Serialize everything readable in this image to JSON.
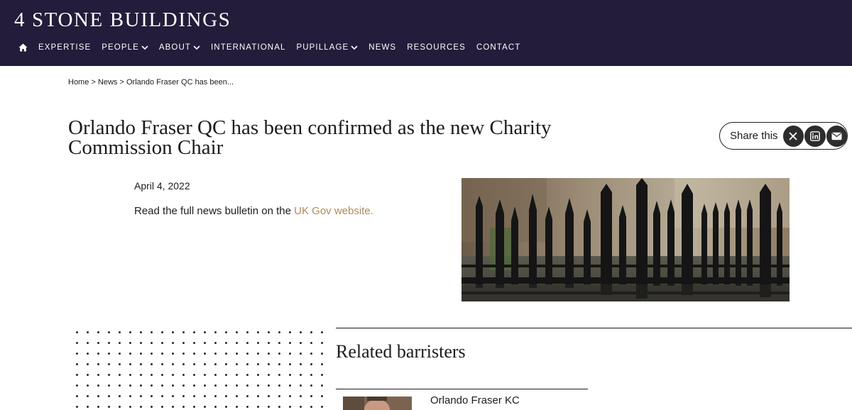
{
  "header": {
    "logo": "4 STONE BUILDINGS",
    "nav": {
      "home_icon": "home-icon",
      "items": [
        {
          "label": "EXPERTISE",
          "dropdown": false
        },
        {
          "label": "PEOPLE",
          "dropdown": true
        },
        {
          "label": "ABOUT",
          "dropdown": true
        },
        {
          "label": "INTERNATIONAL",
          "dropdown": false
        },
        {
          "label": "PUPILLAGE",
          "dropdown": true
        },
        {
          "label": "NEWS",
          "dropdown": false
        },
        {
          "label": "RESOURCES",
          "dropdown": false
        },
        {
          "label": "CONTACT",
          "dropdown": false
        }
      ]
    }
  },
  "breadcrumb": {
    "home": "Home",
    "sep": ">",
    "news": "News",
    "current": "Orlando Fraser QC has been..."
  },
  "article": {
    "title": "Orlando Fraser QC has been confirmed as the new Charity Commission Chair",
    "date": "April 4, 2022",
    "body_prefix": "Read the full news bulletin on the ",
    "body_link": "UK Gov website."
  },
  "share": {
    "label": "Share this",
    "buttons": [
      "x-icon",
      "linkedin-icon",
      "email-icon"
    ]
  },
  "related": {
    "title": "Related barristers",
    "barristers": [
      {
        "name": "Orlando Fraser KC"
      }
    ]
  },
  "colors": {
    "header_bg": "#231c3a",
    "link": "#b08a58",
    "text": "#1c1c1c"
  }
}
